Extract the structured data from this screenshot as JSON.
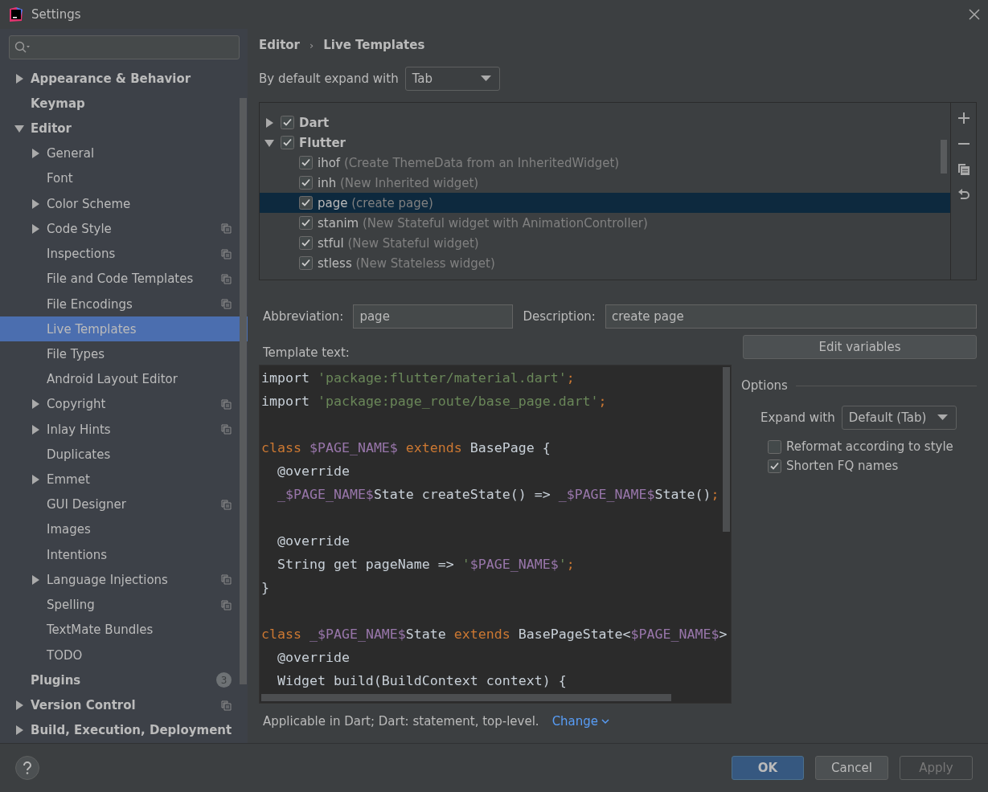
{
  "window": {
    "title": "Settings"
  },
  "sidebar": {
    "items": [
      {
        "label": "Appearance & Behavior",
        "expanded": false,
        "selected": false
      },
      {
        "label": "Keymap",
        "selected": false
      },
      {
        "label": "Editor",
        "expanded": true,
        "selected": false,
        "children": [
          {
            "label": "General",
            "expanded": false,
            "selected": false
          },
          {
            "label": "Font",
            "selected": false
          },
          {
            "label": "Color Scheme",
            "expanded": false,
            "selected": false
          },
          {
            "label": "Code Style",
            "expanded": false,
            "selected": false,
            "project": true
          },
          {
            "label": "Inspections",
            "selected": false,
            "project": true
          },
          {
            "label": "File and Code Templates",
            "selected": false,
            "project": true
          },
          {
            "label": "File Encodings",
            "selected": false,
            "project": true
          },
          {
            "label": "Live Templates",
            "selected": true
          },
          {
            "label": "File Types",
            "selected": false
          },
          {
            "label": "Android Layout Editor",
            "selected": false
          },
          {
            "label": "Copyright",
            "expanded": false,
            "selected": false,
            "project": true
          },
          {
            "label": "Inlay Hints",
            "expanded": false,
            "selected": false,
            "project": true
          },
          {
            "label": "Duplicates",
            "selected": false
          },
          {
            "label": "Emmet",
            "expanded": false,
            "selected": false
          },
          {
            "label": "GUI Designer",
            "selected": false,
            "project": true
          },
          {
            "label": "Images",
            "selected": false
          },
          {
            "label": "Intentions",
            "selected": false
          },
          {
            "label": "Language Injections",
            "expanded": false,
            "selected": false,
            "project": true
          },
          {
            "label": "Spelling",
            "selected": false,
            "project": true
          },
          {
            "label": "TextMate Bundles",
            "selected": false
          },
          {
            "label": "TODO",
            "selected": false
          }
        ]
      },
      {
        "label": "Plugins",
        "selected": false,
        "badge": "3"
      },
      {
        "label": "Version Control",
        "expanded": false,
        "selected": false,
        "project": true
      },
      {
        "label": "Build, Execution, Deployment",
        "expanded": false,
        "selected": false
      }
    ]
  },
  "breadcrumb": {
    "items": [
      "Editor",
      "Live Templates"
    ],
    "separator": "›"
  },
  "expand_default": {
    "label": "By default expand with",
    "value": "Tab"
  },
  "templates": [
    {
      "name": "Dart",
      "checked": true,
      "expanded": false
    },
    {
      "name": "Flutter",
      "checked": true,
      "expanded": true,
      "children": [
        {
          "abbr": "ihof",
          "description": "(Create ThemeData from an InheritedWidget)",
          "checked": true,
          "selected": false
        },
        {
          "abbr": "inh",
          "description": "(New Inherited widget)",
          "checked": true,
          "selected": false
        },
        {
          "abbr": "page",
          "description": "(create page)",
          "checked": true,
          "selected": true
        },
        {
          "abbr": "stanim",
          "description": "(New Stateful widget with AnimationController)",
          "checked": true,
          "selected": false
        },
        {
          "abbr": "stful",
          "description": "(New Stateful widget)",
          "checked": true,
          "selected": false
        },
        {
          "abbr": "stless",
          "description": "(New Stateless widget)",
          "checked": true,
          "selected": false
        }
      ]
    }
  ],
  "abbreviation": {
    "label": "Abbreviation:",
    "value": "page"
  },
  "description": {
    "label": "Description:",
    "value": "create page"
  },
  "template_text": {
    "label": "Template text:",
    "lines": [
      {
        "kind": "code",
        "tokens": [
          {
            "kind": "plain",
            "t": "import "
          },
          {
            "kind": "str",
            "t": "'package:flutter/material.dart'"
          },
          {
            "kind": "kw",
            "t": ";"
          }
        ]
      },
      {
        "kind": "code",
        "tokens": [
          {
            "kind": "plain",
            "t": "import "
          },
          {
            "kind": "str",
            "t": "'package:page_route/base_page.dart'"
          },
          {
            "kind": "kw",
            "t": ";"
          }
        ]
      },
      {
        "kind": "blank"
      },
      {
        "kind": "code",
        "tokens": [
          {
            "kind": "kw",
            "t": "class "
          },
          {
            "kind": "var",
            "t": "$PAGE_NAME$"
          },
          {
            "kind": "kw",
            "t": " extends "
          },
          {
            "kind": "plain",
            "t": "BasePage {"
          }
        ]
      },
      {
        "kind": "code",
        "tokens": [
          {
            "kind": "plain",
            "t": "  @override"
          }
        ]
      },
      {
        "kind": "code",
        "tokens": [
          {
            "kind": "var",
            "t": "  _$PAGE_NAME$"
          },
          {
            "kind": "plain",
            "t": "State createState() => "
          },
          {
            "kind": "var",
            "t": "_$PAGE_NAME$"
          },
          {
            "kind": "plain",
            "t": "State()"
          },
          {
            "kind": "kw",
            "t": ";"
          }
        ]
      },
      {
        "kind": "blank"
      },
      {
        "kind": "code",
        "tokens": [
          {
            "kind": "plain",
            "t": "  @override"
          }
        ]
      },
      {
        "kind": "code",
        "tokens": [
          {
            "kind": "plain",
            "t": "  String get pageName => "
          },
          {
            "kind": "str",
            "t": "'"
          },
          {
            "kind": "var",
            "t": "$PAGE_NAME$"
          },
          {
            "kind": "str",
            "t": "'"
          },
          {
            "kind": "kw",
            "t": ";"
          }
        ]
      },
      {
        "kind": "code",
        "tokens": [
          {
            "kind": "plain",
            "t": "}"
          }
        ]
      },
      {
        "kind": "blank"
      },
      {
        "kind": "code",
        "tokens": [
          {
            "kind": "kw",
            "t": "class "
          },
          {
            "kind": "var",
            "t": "_$PAGE_NAME$"
          },
          {
            "kind": "plain",
            "t": "State"
          },
          {
            "kind": "kw",
            "t": " extends "
          },
          {
            "kind": "plain",
            "t": "BasePageState<"
          },
          {
            "kind": "var",
            "t": "$PAGE_NAME$"
          },
          {
            "kind": "plain",
            "t": ">"
          }
        ]
      },
      {
        "kind": "code",
        "tokens": [
          {
            "kind": "plain",
            "t": "  @override"
          }
        ]
      },
      {
        "kind": "code",
        "tokens": [
          {
            "kind": "plain",
            "t": "  Widget build(BuildContext context) {"
          }
        ]
      }
    ]
  },
  "edit_variables": "Edit variables",
  "options": {
    "title": "Options",
    "expand_label": "Expand with",
    "expand_value": "Default (Tab)",
    "checkboxes": [
      {
        "label": "Reformat according to style",
        "checked": false
      },
      {
        "label": "Shorten FQ names",
        "checked": true
      }
    ]
  },
  "applicable": {
    "text": "Applicable in Dart; Dart: statement, top-level.",
    "link": "Change"
  },
  "buttons": [
    {
      "label": "OK",
      "kind": "primary",
      "disabled": false
    },
    {
      "label": "Cancel",
      "kind": "normal",
      "disabled": false
    },
    {
      "label": "Apply",
      "kind": "normal",
      "disabled": true
    }
  ]
}
